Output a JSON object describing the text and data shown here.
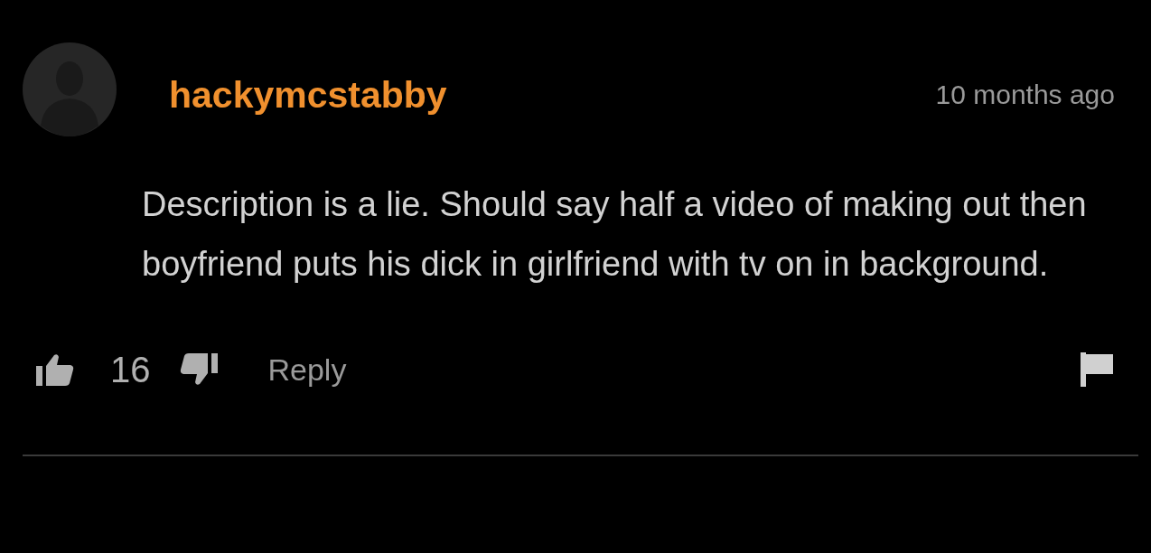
{
  "comment": {
    "username": "hackymcstabby",
    "timestamp": "10 months ago",
    "text": "Description is a lie. Should say half a video of making out then boyfriend puts his dick in girlfriend with tv on in background.",
    "likes": "16",
    "reply": "Reply"
  }
}
